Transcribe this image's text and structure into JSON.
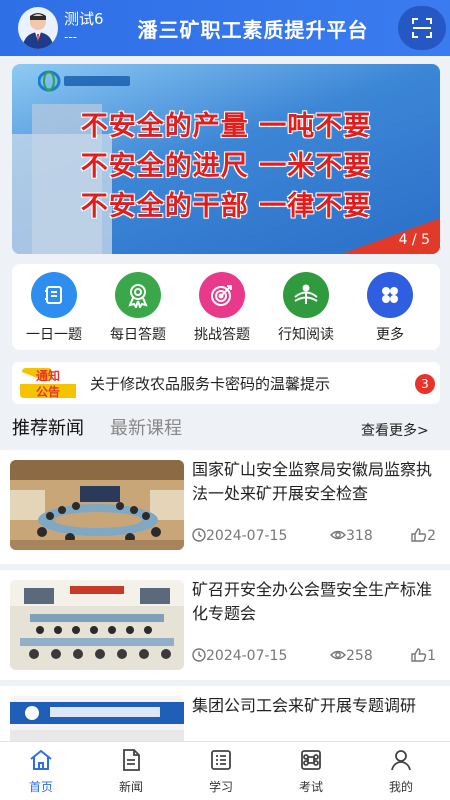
{
  "header": {
    "user_name": "测试6",
    "user_sub": "---",
    "title": "潘三矿职工素质提升平台",
    "scan_icon": "scan-icon"
  },
  "banner": {
    "slogans": [
      "不安全的产量 一吨不要",
      "不安全的进尺 一米不要",
      "不安全的干部 一律不要"
    ],
    "counter": "4 / 5"
  },
  "quick_nav": [
    {
      "label": "一日一题",
      "icon": "daily-question-icon",
      "color": "#2d8ef0"
    },
    {
      "label": "每日答题",
      "icon": "medal-icon",
      "color": "#3aa84a"
    },
    {
      "label": "挑战答题",
      "icon": "target-icon",
      "color": "#e8398a"
    },
    {
      "label": "行知阅读",
      "icon": "reading-icon",
      "color": "#2f9a3e"
    },
    {
      "label": "更多",
      "icon": "more-grid-icon",
      "color": "#2f5fe0"
    }
  ],
  "notice": {
    "badge_line1": "通知",
    "badge_line2": "公告",
    "text": "关于修改农品服务卡密码的温馨提示",
    "count": "3"
  },
  "tabs": {
    "recommended": "推荐新闻",
    "latest": "最新课程",
    "more": "查看更多>"
  },
  "news": [
    {
      "title": "国家矿山安全监察局安徽局监察执法一处来矿开展安全检查",
      "date": "2024-07-15",
      "views": "318",
      "likes": "2"
    },
    {
      "title": "矿召开安全办公会暨安全生产标准化专题会",
      "date": "2024-07-15",
      "views": "258",
      "likes": "1"
    },
    {
      "title": "集团公司工会来矿开展专题调研",
      "date": "",
      "views": "",
      "likes": ""
    }
  ],
  "bottom_nav": [
    {
      "label": "首页",
      "icon": "home-icon"
    },
    {
      "label": "新闻",
      "icon": "news-icon"
    },
    {
      "label": "学习",
      "icon": "study-icon"
    },
    {
      "label": "考试",
      "icon": "exam-icon"
    },
    {
      "label": "我的",
      "icon": "profile-icon"
    }
  ],
  "colors": {
    "primary": "#2f6fe6",
    "badge": "#e8332a",
    "banner_text": "#e21d1d"
  }
}
